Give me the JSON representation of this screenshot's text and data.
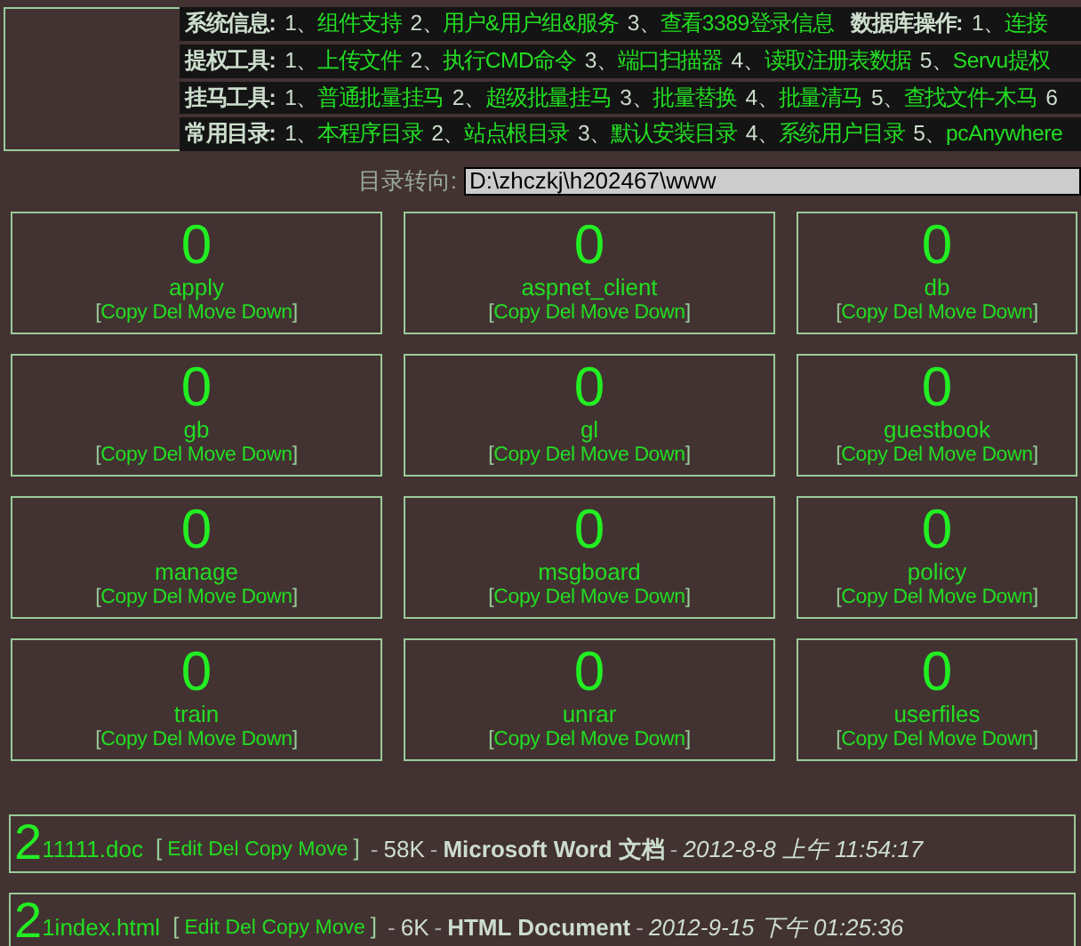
{
  "menu": [
    {
      "segments": [
        {
          "kind": "label",
          "text": "系统信息:"
        },
        {
          "kind": "num",
          "text": "1、"
        },
        {
          "kind": "link",
          "text": "组件支持"
        },
        {
          "kind": "num",
          "text": "2、"
        },
        {
          "kind": "link",
          "text": "用户&用户组&服务"
        },
        {
          "kind": "num",
          "text": "3、"
        },
        {
          "kind": "link",
          "text": "查看3389登录信息"
        },
        {
          "kind": "label",
          "text": "数据库操作:"
        },
        {
          "kind": "num",
          "text": "1、"
        },
        {
          "kind": "link",
          "text": "连接"
        }
      ]
    },
    {
      "segments": [
        {
          "kind": "label",
          "text": "提权工具:"
        },
        {
          "kind": "num",
          "text": "1、"
        },
        {
          "kind": "link",
          "text": "上传文件"
        },
        {
          "kind": "num",
          "text": "2、"
        },
        {
          "kind": "link",
          "text": "执行CMD命令"
        },
        {
          "kind": "num",
          "text": "3、"
        },
        {
          "kind": "link",
          "text": "端口扫描器"
        },
        {
          "kind": "num",
          "text": "4、"
        },
        {
          "kind": "link",
          "text": "读取注册表数据"
        },
        {
          "kind": "num",
          "text": "5、"
        },
        {
          "kind": "link",
          "text": "Servu提权"
        }
      ]
    },
    {
      "segments": [
        {
          "kind": "label",
          "text": "挂马工具:"
        },
        {
          "kind": "num",
          "text": "1、"
        },
        {
          "kind": "link",
          "text": "普通批量挂马"
        },
        {
          "kind": "num",
          "text": "2、"
        },
        {
          "kind": "link",
          "text": "超级批量挂马"
        },
        {
          "kind": "num",
          "text": "3、"
        },
        {
          "kind": "link",
          "text": "批量替换"
        },
        {
          "kind": "num",
          "text": "4、"
        },
        {
          "kind": "link",
          "text": "批量清马"
        },
        {
          "kind": "num",
          "text": "5、"
        },
        {
          "kind": "link",
          "text": "查找文件-木马"
        },
        {
          "kind": "num",
          "text": "6"
        }
      ]
    },
    {
      "segments": [
        {
          "kind": "label",
          "text": "常用目录:"
        },
        {
          "kind": "num",
          "text": "1、"
        },
        {
          "kind": "link",
          "text": "本程序目录"
        },
        {
          "kind": "num",
          "text": "2、"
        },
        {
          "kind": "link",
          "text": "站点根目录"
        },
        {
          "kind": "num",
          "text": "3、"
        },
        {
          "kind": "link",
          "text": "默认安装目录"
        },
        {
          "kind": "num",
          "text": "4、"
        },
        {
          "kind": "link",
          "text": "系统用户目录"
        },
        {
          "kind": "num",
          "text": "5、"
        },
        {
          "kind": "link",
          "text": "pcAnywhere"
        }
      ]
    }
  ],
  "path": {
    "label": "目录转向:",
    "value": "D:\\zhczkj\\h202467\\www"
  },
  "folders": [
    {
      "count": "0",
      "name": "apply",
      "open": "[",
      "actions": [
        "Copy",
        "Del",
        "Move",
        "Down"
      ],
      "close": "]"
    },
    {
      "count": "0",
      "name": "aspnet_client",
      "open": "[",
      "actions": [
        "Copy",
        "Del",
        "Move",
        "Down"
      ],
      "close": "]"
    },
    {
      "count": "0",
      "name": "db",
      "open": "[",
      "actions": [
        "Copy",
        "Del",
        "Move",
        "Down"
      ],
      "close": "]"
    },
    {
      "count": "0",
      "name": "gb",
      "open": "[",
      "actions": [
        "Copy",
        "Del",
        "Move",
        "Down"
      ],
      "close": "]"
    },
    {
      "count": "0",
      "name": "gl",
      "open": "[",
      "actions": [
        "Copy",
        "Del",
        "Move",
        "Down"
      ],
      "close": "]"
    },
    {
      "count": "0",
      "name": "guestbook",
      "open": "[",
      "actions": [
        "Copy",
        "Del",
        "Move",
        "Down"
      ],
      "close": "]"
    },
    {
      "count": "0",
      "name": "manage",
      "open": "[",
      "actions": [
        "Copy",
        "Del",
        "Move",
        "Down"
      ],
      "close": "]"
    },
    {
      "count": "0",
      "name": "msgboard",
      "open": "[",
      "actions": [
        "Copy",
        "Del",
        "Move",
        "Down"
      ],
      "close": "]"
    },
    {
      "count": "0",
      "name": "policy",
      "open": "[",
      "actions": [
        "Copy",
        "Del",
        "Move",
        "Down"
      ],
      "close": "]"
    },
    {
      "count": "0",
      "name": "train",
      "open": "[",
      "actions": [
        "Copy",
        "Del",
        "Move",
        "Down"
      ],
      "close": "]"
    },
    {
      "count": "0",
      "name": "unrar",
      "open": "[",
      "actions": [
        "Copy",
        "Del",
        "Move",
        "Down"
      ],
      "close": "]"
    },
    {
      "count": "0",
      "name": "userfiles",
      "open": "[",
      "actions": [
        "Copy",
        "Del",
        "Move",
        "Down"
      ],
      "close": "]"
    }
  ],
  "files": [
    {
      "mark": "2",
      "name": "11111.doc",
      "open": "[",
      "actions": [
        "Edit",
        "Del",
        "Copy",
        "Move"
      ],
      "close": "]",
      "dash_1": "-",
      "size": "58K",
      "dash_2": "-",
      "type": "Microsoft Word 文档",
      "dash_3": "-",
      "date": "2012-8-8 上午 11:54:17"
    },
    {
      "mark": "2",
      "name": "1index.html",
      "open": "[",
      "actions": [
        "Edit",
        "Del",
        "Copy",
        "Move"
      ],
      "close": "]",
      "dash_1": "-",
      "size": "6K",
      "dash_2": "-",
      "type": "HTML Document",
      "dash_3": "-",
      "date": "2012-9-15 下午 01:25:36"
    }
  ]
}
